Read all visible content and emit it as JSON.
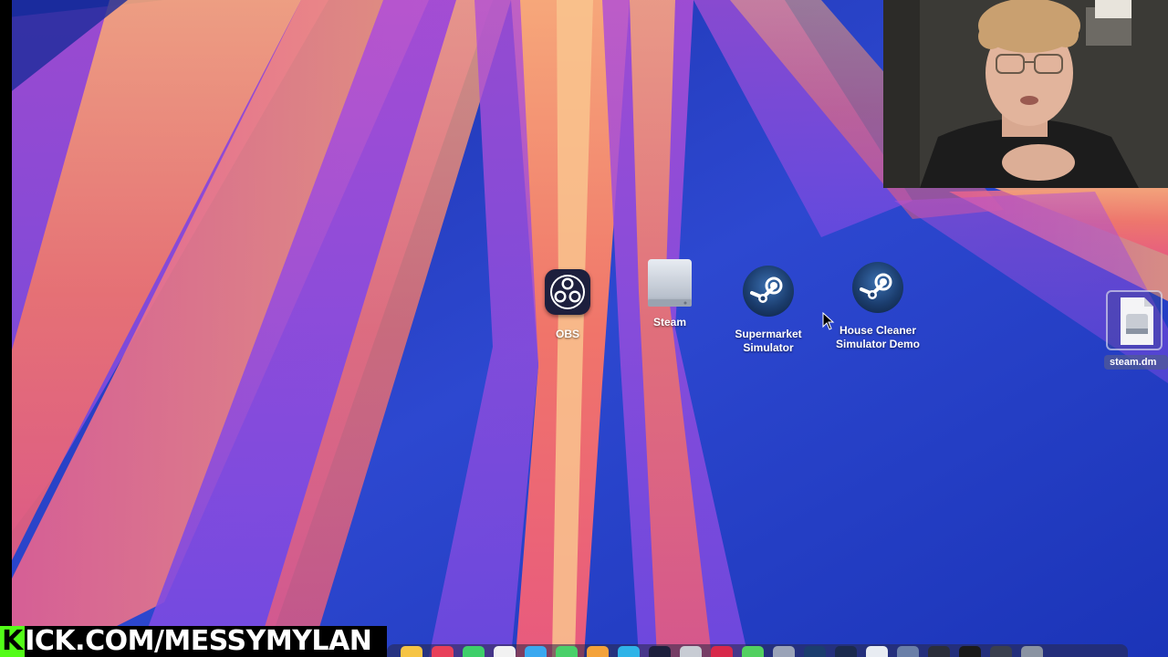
{
  "desktop": {
    "icons": [
      {
        "label": "OBS",
        "icon": "obs-icon"
      },
      {
        "label": "Steam",
        "icon": "disk-image-icon"
      },
      {
        "label": "Supermarket\nSimulator",
        "icon": "steam-icon"
      },
      {
        "label": "House Cleaner\nSimulator Demo",
        "icon": "steam-icon"
      }
    ],
    "selected_file": {
      "label": "steam.dm",
      "icon": "dmg-file-icon"
    }
  },
  "stream": {
    "banner_k": "K",
    "banner_rest": "ICK.COM/MESSYMYLAN"
  },
  "colors": {
    "kick_green": "#53fc18",
    "wallpaper_blue": "#2848c8",
    "wallpaper_orange": "#f07a5a",
    "wallpaper_purple": "#9a4ad8"
  }
}
